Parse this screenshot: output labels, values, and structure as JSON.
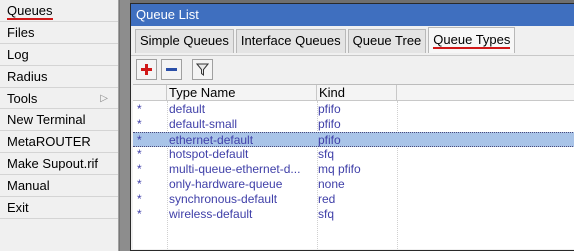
{
  "sidebar": {
    "items": [
      {
        "label": "Queues",
        "active": true
      },
      {
        "label": "Files"
      },
      {
        "label": "Log"
      },
      {
        "label": "Radius"
      },
      {
        "label": "Tools",
        "submenu": true
      },
      {
        "label": "New Terminal"
      },
      {
        "label": "MetaROUTER"
      },
      {
        "label": "Make Supout.rif"
      },
      {
        "label": "Manual"
      },
      {
        "label": "Exit"
      }
    ],
    "submenu_arrow": "▷"
  },
  "window": {
    "title": "Queue List",
    "tabs": [
      {
        "label": "Simple Queues"
      },
      {
        "label": "Interface Queues"
      },
      {
        "label": "Queue Tree"
      },
      {
        "label": "Queue Types",
        "active": true
      }
    ],
    "toolbar": {
      "icons": [
        "add-icon",
        "remove-icon",
        "filter-icon"
      ],
      "accent_red": "#d01818",
      "accent_blue": "#2a4fa8"
    },
    "table": {
      "columns": [
        "Type Name",
        "Kind"
      ],
      "rows": [
        {
          "flag": "*",
          "name": "default",
          "kind": "pfifo"
        },
        {
          "flag": "*",
          "name": "default-small",
          "kind": "pfifo"
        },
        {
          "flag": "*",
          "name": "ethernet-default",
          "kind": "pfifo",
          "selected": true
        },
        {
          "flag": "*",
          "name": "hotspot-default",
          "kind": "sfq"
        },
        {
          "flag": "*",
          "name": "multi-queue-ethernet-d...",
          "kind": "mq pfifo"
        },
        {
          "flag": "*",
          "name": "only-hardware-queue",
          "kind": "none"
        },
        {
          "flag": "*",
          "name": "synchronous-default",
          "kind": "red"
        },
        {
          "flag": "*",
          "name": "wireless-default",
          "kind": "sfq"
        }
      ]
    }
  }
}
